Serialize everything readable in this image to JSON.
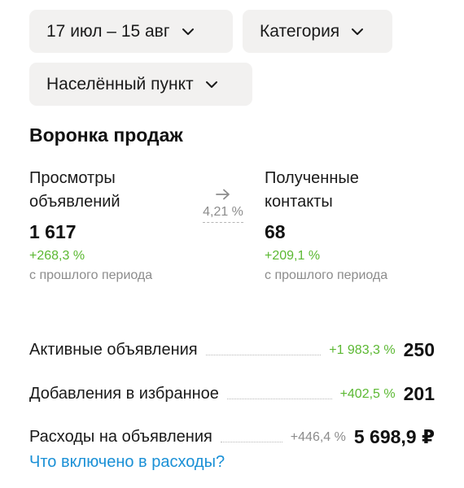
{
  "filters": {
    "date_range": "17 июл – 15 авг",
    "category": "Категория",
    "location": "Населённый пункт"
  },
  "funnel": {
    "title": "Воронка продаж",
    "views": {
      "label": "Просмотры объявлений",
      "value": "1 617",
      "delta": "+268,3 %",
      "period": "с прошлого периода"
    },
    "conversion": "4,21 %",
    "contacts": {
      "label": "Полученные контакты",
      "value": "68",
      "delta": "+209,1 %",
      "period": "с прошлого периода"
    }
  },
  "stats": {
    "active": {
      "label": "Активные объявления",
      "delta": "+1 983,3 %",
      "value": "250"
    },
    "favorites": {
      "label": "Добавления в избранное",
      "delta": "+402,5 %",
      "value": "201"
    },
    "costs": {
      "label": "Расходы на объявления",
      "delta": "+446,4 %",
      "value": "5 698,9 ₽"
    }
  },
  "costs_link": "Что включено в расходы?",
  "colors": {
    "chip_bg": "#f2f1f0",
    "positive": "#5bb832",
    "muted": "#8c8c8c",
    "link": "#1a90d6"
  },
  "icons": {
    "chip_chevron": "chevron-down-icon",
    "conversion_arrow": "arrow-right-icon"
  }
}
